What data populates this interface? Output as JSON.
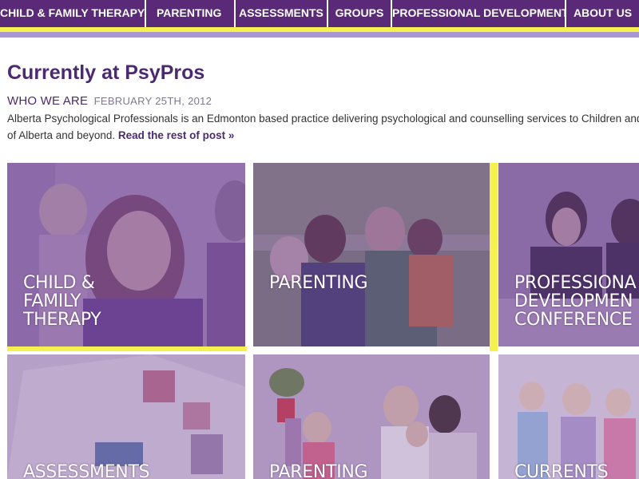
{
  "nav": {
    "items": [
      {
        "label": "CHILD & FAMILY THERAPY"
      },
      {
        "label": "PARENTING"
      },
      {
        "label": "ASSESSMENTS"
      },
      {
        "label": "GROUPS"
      },
      {
        "label": "PROFESSIONAL DEVELOPMENT"
      },
      {
        "label": "ABOUT US"
      }
    ]
  },
  "main": {
    "title": "Currently at PsyPros",
    "post": {
      "category": "WHO WE ARE",
      "date": "FEBRUARY 25TH, 2012",
      "excerpt_line1": "Alberta Psychological Professionals is an Edmonton based practice delivering psychological and counselling services to Children and F",
      "excerpt_line2": "of Alberta and beyond.",
      "read_more": "Read the rest of post »"
    }
  },
  "tiles": [
    {
      "line1": "CHILD &",
      "line2": "FAMILY",
      "line3": "THERAPY"
    },
    {
      "line1": "PARENTING"
    },
    {
      "line1": "PROFESSIONA",
      "line2": "DEVELOPMEN",
      "line3": "CONFERENCE"
    },
    {
      "line1": "ASSESSMENTS"
    },
    {
      "line1": "PARENTING"
    },
    {
      "line1": "CURRENTS"
    }
  ],
  "colors": {
    "nav_bg": "#5a2a78",
    "accent_yellow": "#f7f14f",
    "accent_lavender": "#a799cf",
    "title_purple": "#4b2a6f"
  }
}
